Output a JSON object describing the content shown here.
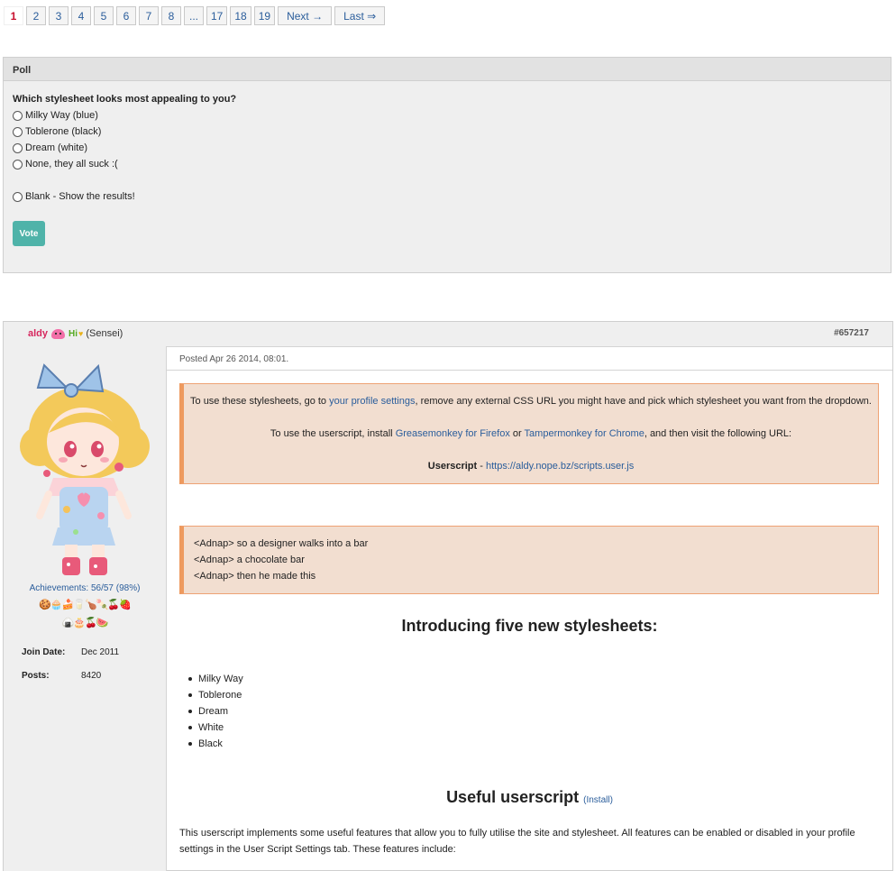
{
  "pagination": {
    "pages": [
      "1",
      "2",
      "3",
      "4",
      "5",
      "6",
      "7",
      "8",
      "...",
      "17",
      "18",
      "19"
    ],
    "current": "1",
    "next": "Next →",
    "last": "Last ⇒"
  },
  "poll": {
    "heading": "Poll",
    "question": "Which stylesheet looks most appealing to you?",
    "options": [
      "Milky Way (blue)",
      "Toblerone (black)",
      "Dream (white)",
      "None, they all suck :("
    ],
    "blank_option": "Blank - Show the results!",
    "vote_label": "Vote"
  },
  "post": {
    "author": "aldy",
    "author_badge_text": "Hi",
    "rank": "(Sensei)",
    "post_id": "#657217",
    "posted": "Posted Apr 26 2014, 08:01.",
    "sidebar": {
      "achievements": "Achievements: 56/57 (98%)",
      "badges_row1": "🍪🧁🍰🥛🍗🍡🍒🍓",
      "badges_row2": "🍙🎂🍒🍉",
      "join_label": "Join Date:",
      "join_value": "Dec 2011",
      "posts_label": "Posts:",
      "posts_value": "8420"
    },
    "notice1": {
      "line1_pre": "To use these stylesheets, go to ",
      "line1_link": "your profile settings",
      "line1_post": ", remove any external CSS URL you might have and pick which stylesheet you want from the dropdown.",
      "line2_pre": "To use the userscript, install ",
      "line2_link1": "Greasemonkey for Firefox",
      "line2_mid": " or ",
      "line2_link2": "Tampermonkey for Chrome",
      "line2_post": ", and then visit the following URL:",
      "line3_bold": "Userscript",
      "line3_sep": " - ",
      "line3_link": "https://aldy.nope.bz/scripts.user.js"
    },
    "quote": [
      "<Adnap> so a designer walks into a bar",
      "<Adnap> a chocolate bar",
      "<Adnap> then he made this"
    ],
    "heading_intro": "Introducing five new stylesheets:",
    "stylesheets": [
      "Milky Way",
      "Toblerone",
      "Dream",
      "White",
      "Black"
    ],
    "heading_useful": "Useful userscript",
    "install_link": "(Install)",
    "description": "This userscript implements some useful features that allow you to fully utilise the site and stylesheet. All features can be enabled or disabled in your profile settings in the User Script Settings tab. These features include:"
  },
  "colors": {
    "accent_teal": "#4fb3a9",
    "notice_border": "#ee9a5e",
    "notice_bg": "#f2ded0",
    "username": "#d6275e",
    "link": "#2a5d9b"
  }
}
